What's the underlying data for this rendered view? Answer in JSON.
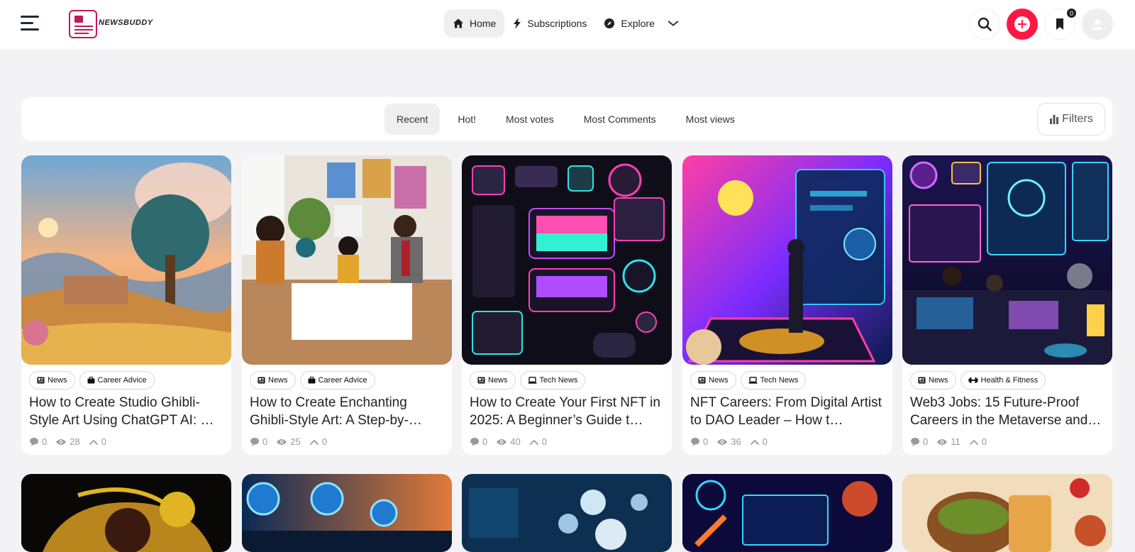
{
  "app": {
    "logo_text": "NEWSBUDDY"
  },
  "nav": {
    "items": [
      {
        "label": "Home",
        "icon": "home-icon",
        "active": true
      },
      {
        "label": "Subscriptions",
        "icon": "bolt-icon",
        "active": false
      },
      {
        "label": "Explore",
        "icon": "compass-icon",
        "active": false
      }
    ]
  },
  "header": {
    "bookmark_count": "0"
  },
  "sort": {
    "tabs": [
      "Recent",
      "Hot!",
      "Most votes",
      "Most Comments",
      "Most views"
    ],
    "active": "Recent",
    "filters_label": "Filters"
  },
  "posts": [
    {
      "title": "How to Create Studio Ghibli-Style Art Using ChatGPT AI: …",
      "tags": [
        "News",
        "Career Advice"
      ],
      "comments": "0",
      "views": "28",
      "votes": "0"
    },
    {
      "title": "How to Create Enchanting Ghibli-Style Art: A Step-by-…",
      "tags": [
        "News",
        "Career Advice"
      ],
      "comments": "0",
      "views": "25",
      "votes": "0"
    },
    {
      "title": "How to Create Your First NFT in 2025: A Beginner’s Guide t…",
      "tags": [
        "News",
        "Tech News"
      ],
      "comments": "0",
      "views": "40",
      "votes": "0"
    },
    {
      "title": "NFT Careers: From Digital Artist to DAO Leader – How t…",
      "tags": [
        "News",
        "Tech News"
      ],
      "comments": "0",
      "views": "36",
      "votes": "0"
    },
    {
      "title": "Web3 Jobs: 15 Future-Proof Careers in the Metaverse and…",
      "tags": [
        "News",
        "Health & Fitness"
      ],
      "comments": "0",
      "views": "11",
      "votes": "0"
    }
  ],
  "colors": {
    "accent": "#ff1744",
    "brand": "#c2185b",
    "text": "#222222",
    "muted": "#9a9a9a"
  }
}
